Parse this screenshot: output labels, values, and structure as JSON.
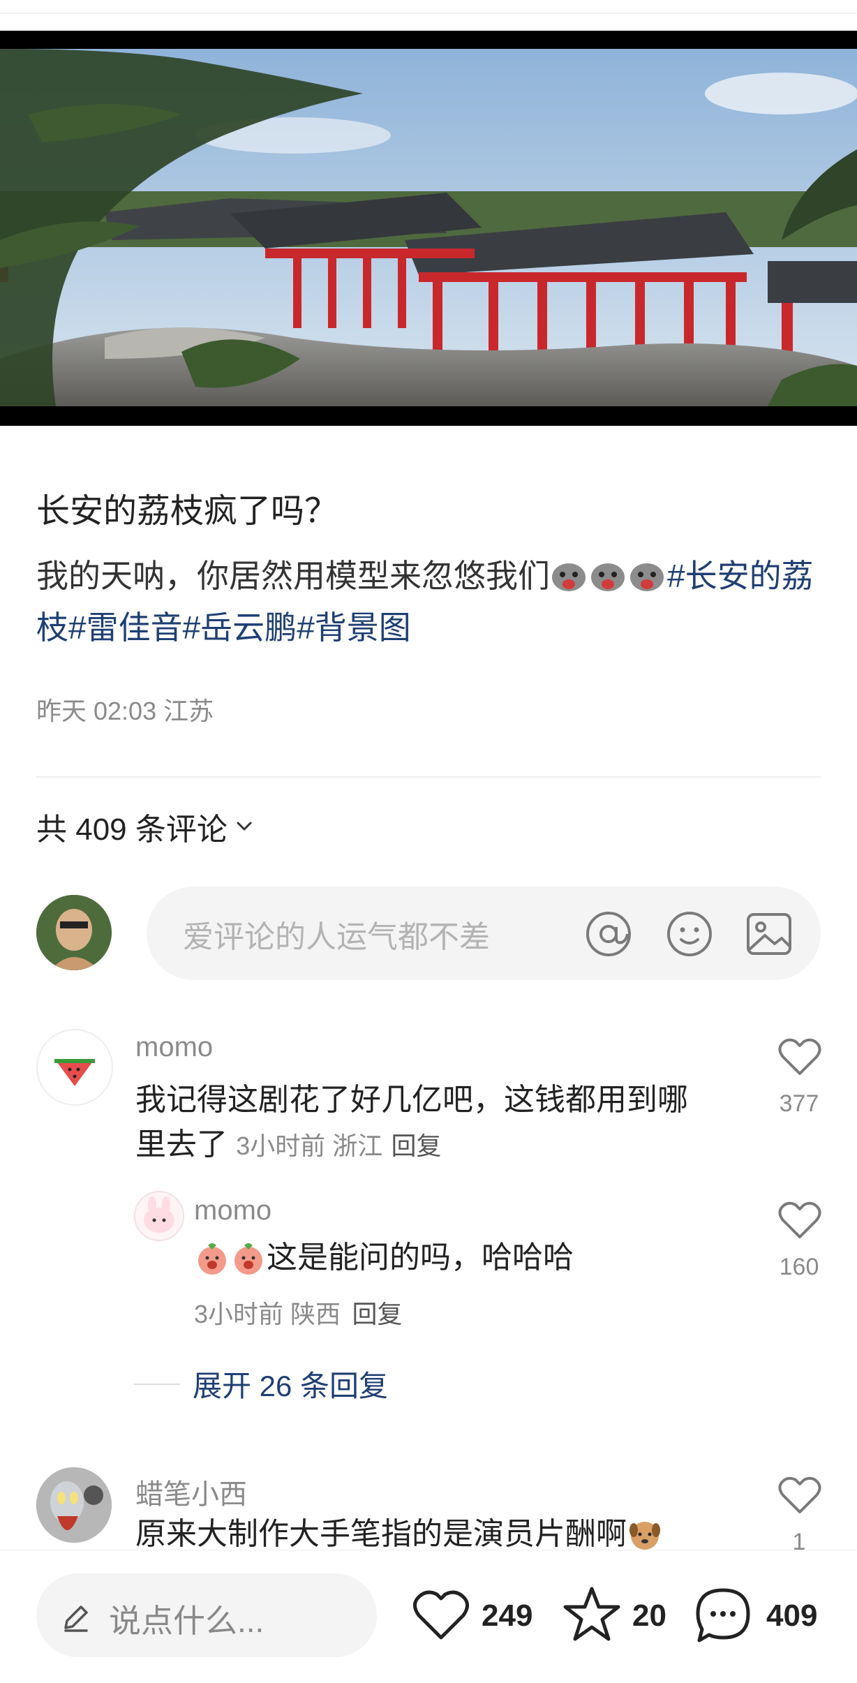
{
  "post": {
    "title": "长安的荔枝疯了吗？",
    "desc_text": "我的天呐，你居然用模型来忽悠我们",
    "desc_tags": [
      "#长安的荔枝",
      "#雷佳音",
      "#岳云鹏",
      "#背景图"
    ],
    "tag_prefix_char": "#长",
    "tag_line1": "#长",
    "tag_line2_a": "安的荔枝",
    "meta": "昨天 02:03 江苏"
  },
  "comments_header": {
    "label": "共 409 条评论",
    "icon": "chevron-down-icon"
  },
  "comment_input": {
    "placeholder": "爱评论的人运气都不差",
    "icons": [
      "at-icon",
      "emoji-icon",
      "image-icon"
    ]
  },
  "comments": [
    {
      "name": "momo",
      "text_line1": "我记得这剧花了好几亿吧，这钱都用到哪",
      "text_line2": "里去了",
      "sub": "3小时前 浙江",
      "reply_label": "回复",
      "likes": "377",
      "avatar": "watermelon-avatar"
    },
    {
      "name": "momo",
      "text": "这是能问的吗，哈哈哈",
      "sub": "3小时前 陕西",
      "reply_label": "回复",
      "likes": "160",
      "avatar": "pink-bunny-avatar"
    },
    {
      "name": "蜡笔小西",
      "text": "原来大制作大手笔指的是演员片酬啊",
      "likes": "1",
      "avatar": "ultraman-avatar"
    }
  ],
  "expand_replies": "展开 26 条回复",
  "bottom_bar": {
    "placeholder": "说点什么...",
    "likes": "249",
    "stars": "20",
    "comments": "409"
  },
  "colors": {
    "tag": "#1f3f73",
    "input_bg": "#f4f4f4",
    "muted": "#8a8a8a"
  }
}
